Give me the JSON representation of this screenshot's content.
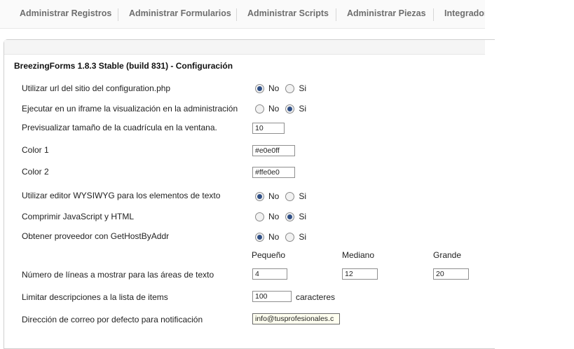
{
  "tabs": [
    {
      "label": "Administrar Registros"
    },
    {
      "label": "Administrar Formularios"
    },
    {
      "label": "Administrar Scripts"
    },
    {
      "label": "Administrar Piezas"
    },
    {
      "label": "Integrador"
    }
  ],
  "panel": {
    "title": "BreezingForms 1.8.3 Stable (build 831) - Configuración"
  },
  "options": {
    "no_label": "No",
    "si_label": "Si"
  },
  "settings": {
    "site_url": {
      "label": "Utilizar url del sitio del configuration.php",
      "selected": "No"
    },
    "iframe": {
      "label": "Ejecutar en un iframe la visualización en la administración",
      "selected": "Si"
    },
    "grid_size": {
      "label": "Previsualizar tamaño de la cuadrícula en la ventana.",
      "value": "10"
    },
    "color1": {
      "label": "Color 1",
      "value": "#e0e0ff"
    },
    "color2": {
      "label": "Color 2",
      "value": "#ffe0e0"
    },
    "wysiwyg": {
      "label": "Utilizar editor WYSIWYG para los elementos de texto",
      "selected": "No"
    },
    "compress": {
      "label": "Comprimir JavaScript y HTML",
      "selected": "Si"
    },
    "gethost": {
      "label": "Obtener proveedor con GetHostByAddr",
      "selected": "No"
    },
    "sizes": {
      "small": "Pequeño",
      "medium": "Mediano",
      "large": "Grande"
    },
    "textarea_lines": {
      "label": "Número de líneas a mostrar para las áreas de texto",
      "small": "4",
      "medium": "12",
      "large": "20"
    },
    "limit_desc": {
      "label": "Limitar descripciones a la lista de items",
      "value": "100",
      "suffix": "caracteres"
    },
    "email": {
      "label": "Dirección de correo por defecto para notificación",
      "value": "info@tusprofesionales.c"
    }
  }
}
